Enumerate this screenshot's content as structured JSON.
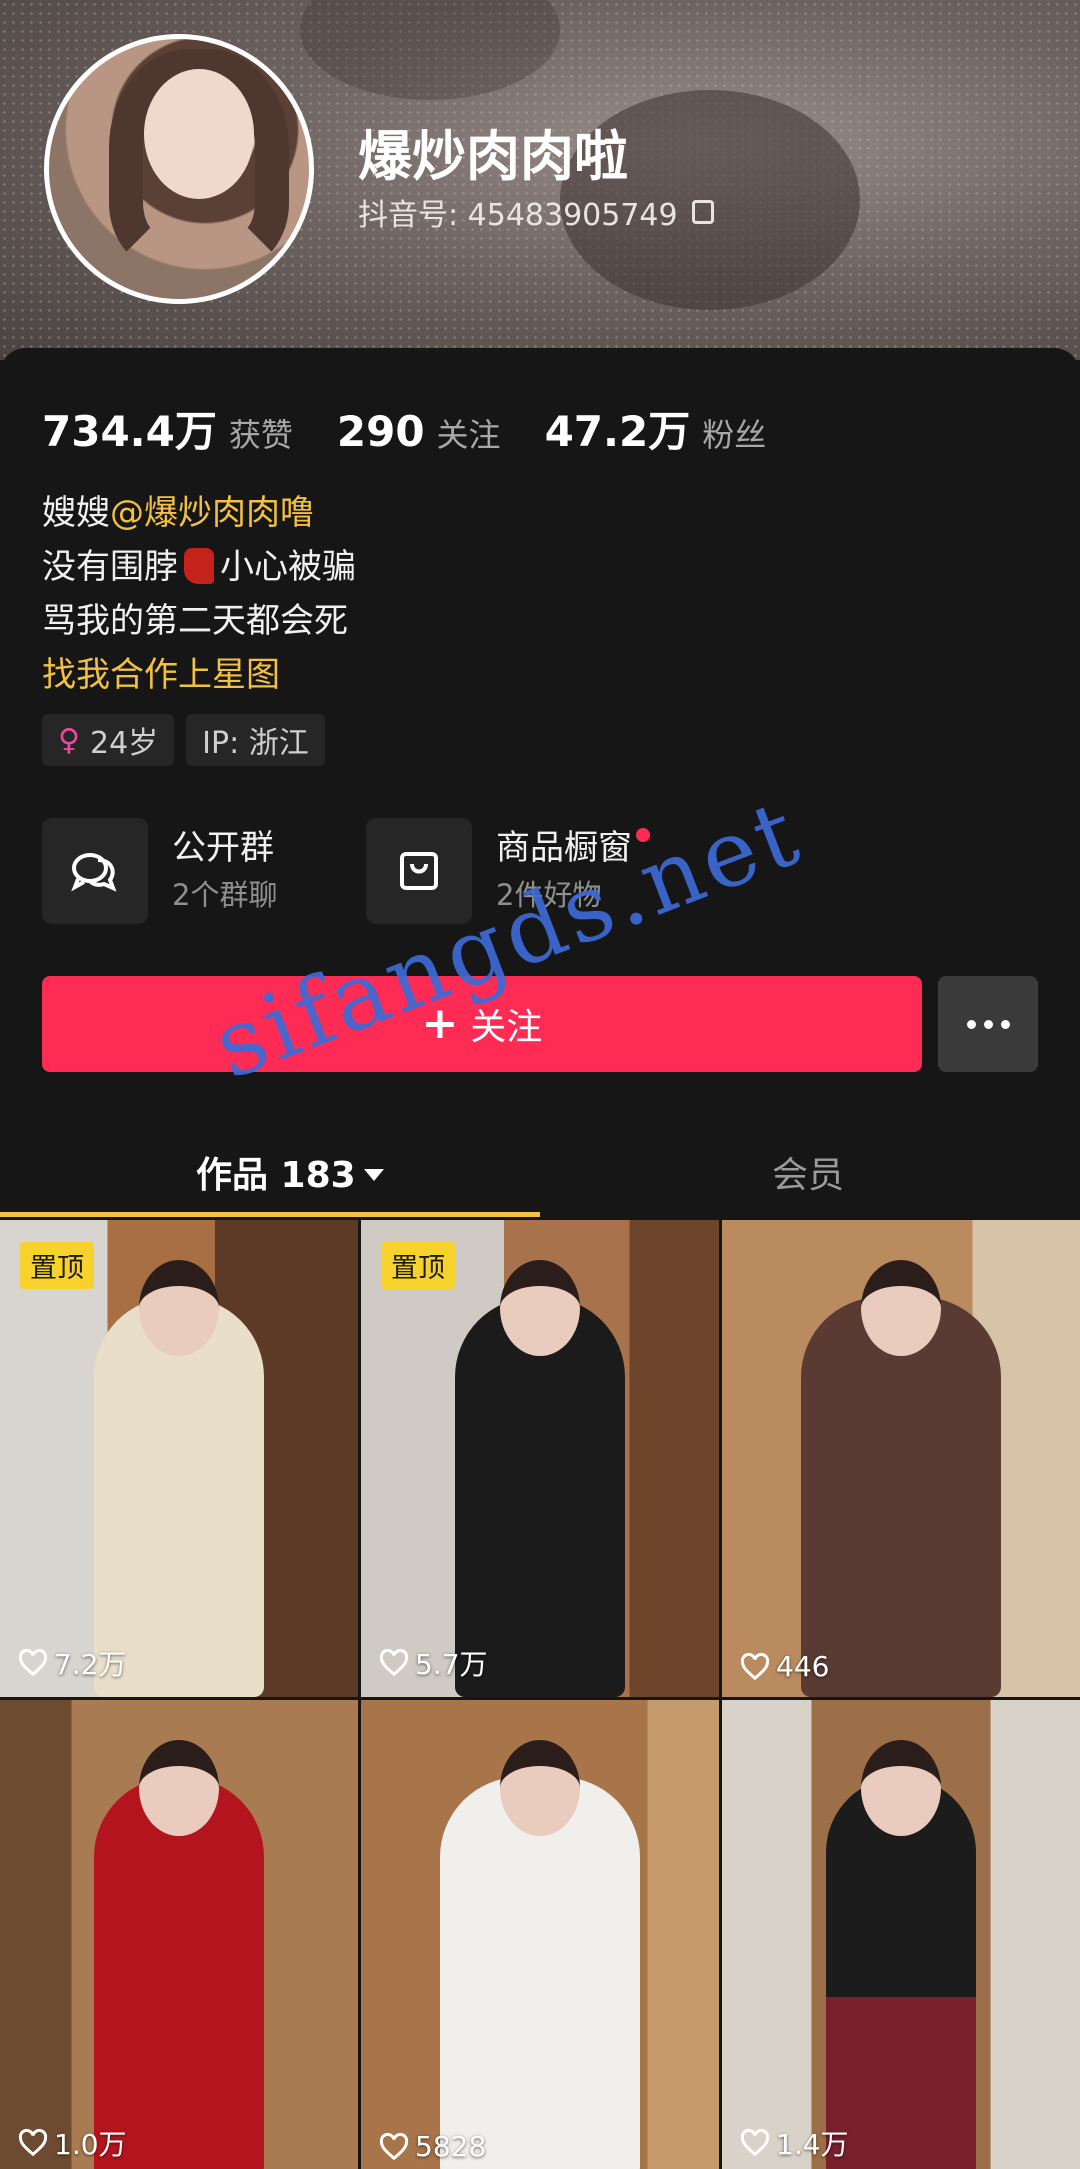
{
  "profile": {
    "username": "爆炒肉肉啦",
    "douyin_id": "抖音号: 45483905749"
  },
  "stats": [
    {
      "value": "734.4万",
      "label": "获赞"
    },
    {
      "value": "290",
      "label": "关注"
    },
    {
      "value": "47.2万",
      "label": "粉丝"
    }
  ],
  "bio": {
    "line1_prefix": "嫂嫂",
    "line1_mention": "@爆炒肉肉噜",
    "line2_before": "没有围脖",
    "line2_after": "小心被骗",
    "line3": "骂我的第二天都会死",
    "line4_link": "找我合作上星图"
  },
  "tags": {
    "age": "24岁",
    "ip": "IP: 浙江"
  },
  "entries": [
    {
      "title": "公开群",
      "subtitle": "2个群聊",
      "icon": "chat-bubbles-icon"
    },
    {
      "title": "商品橱窗",
      "subtitle": "2件好物",
      "icon": "shopping-bag-icon"
    }
  ],
  "actions": {
    "follow_label": "关注",
    "more_icon": "more-dots-icon"
  },
  "tabs": {
    "works_label": "作品 183",
    "member_label": "会员"
  },
  "videos": [
    {
      "pinned": true,
      "pin_label": "置顶",
      "likes": "7.2万"
    },
    {
      "pinned": true,
      "pin_label": "置顶",
      "likes": "5.7万"
    },
    {
      "pinned": false,
      "likes": "446"
    },
    {
      "pinned": false,
      "likes": "1.0万"
    },
    {
      "pinned": false,
      "likes": "5828"
    },
    {
      "pinned": false,
      "likes": "1.4万"
    }
  ],
  "watermark": "sifangds.net",
  "colors": {
    "accent": "#fe2c55",
    "highlight": "#f3c141",
    "background": "#161616",
    "watermark": "#3d6ad6"
  }
}
